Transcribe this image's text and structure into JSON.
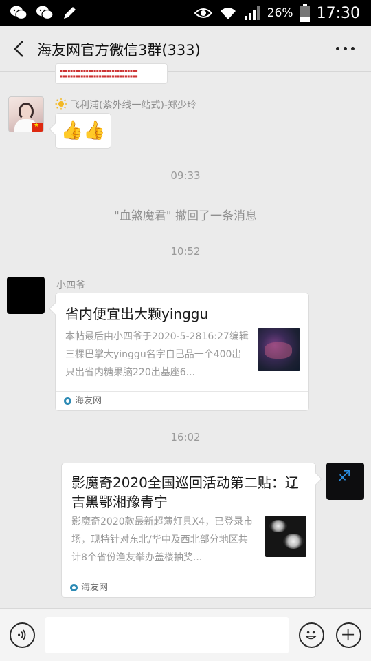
{
  "status_bar": {
    "battery_percent": "26%",
    "time": "17:30"
  },
  "header": {
    "title": "海友网官方微信3群(333)"
  },
  "messages": {
    "sender1_name": "飞利浦(紫外线一站式)-郑少玲",
    "sender1_text": "👍👍",
    "time1": "09:33",
    "recall_notice": "\"血煞魔君\" 撤回了一条消息",
    "time2": "10:52",
    "sender2_name": "小四爷",
    "card1": {
      "title": "省内便宜出大颗yinggu",
      "desc": "本帖最后由小四爷于2020-5-2816:27编辑三棵巴掌大yinggu名字自己品一个400出只出省内糖果脑220出基座6...",
      "source": "海友网"
    },
    "time3": "16:02",
    "card2": {
      "title": "影魔奇2020全国巡回活动第二贴：辽吉黑鄂湘豫青宁",
      "desc": "影魔奇2020款最新超薄灯具X4，已登录市场，现特针对东北/华中及西北部分地区共计8个省份渔友举办盖楼抽奖...",
      "source": "海友网"
    }
  },
  "icons": {
    "back": "back-arrow-icon",
    "more": "more-dots-icon",
    "voice": "voice-icon",
    "emoji": "emoji-icon",
    "plus": "plus-icon"
  }
}
